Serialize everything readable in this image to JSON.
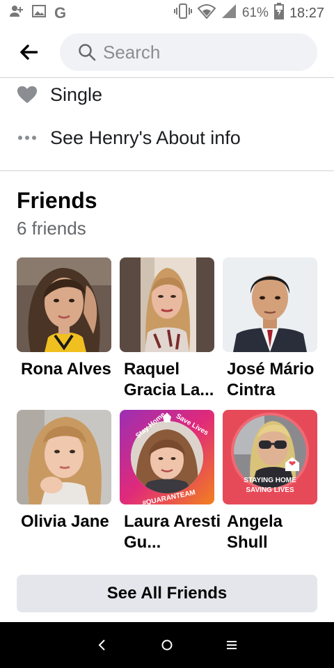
{
  "status_bar": {
    "battery_percent": "61%",
    "time": "18:27",
    "icons": [
      "person-add-icon",
      "image-icon",
      "google-icon",
      "vibrate-icon",
      "wifi-icon",
      "signal-icon",
      "battery-icon"
    ],
    "g_glyph": "G"
  },
  "header": {
    "back_icon": "back-arrow-icon",
    "search_placeholder": "Search"
  },
  "info": {
    "relationship": "Single",
    "see_about": "See Henry's About info"
  },
  "friends": {
    "title": "Friends",
    "count": "6 friends",
    "list": [
      {
        "name": "Rona Alves"
      },
      {
        "name": "Raquel Gracia La..."
      },
      {
        "name": "José Mário Cintra"
      },
      {
        "name": "Olivia Jane"
      },
      {
        "name": "Laura Aresti Gu..."
      },
      {
        "name": "Angela Shull"
      }
    ],
    "see_all": "See All Friends"
  },
  "photo_text": {
    "laura_top": "Stay Home",
    "laura_top2": "Save Lives",
    "laura_bottom": "#QUARANTEAM",
    "angela_line1": "STAYING HOME",
    "angela_line2": "SAVING LIVES"
  },
  "colors": {
    "accent_bg": "#e4e6eb",
    "search_bg": "#f0f2f5",
    "text_secondary": "#65676b"
  }
}
